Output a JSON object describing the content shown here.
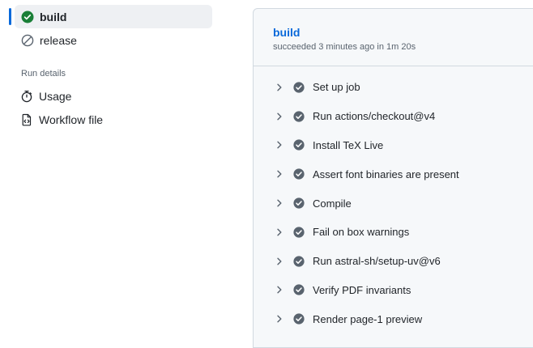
{
  "sidebar": {
    "jobs": [
      {
        "label": "build",
        "icon": "check-circle-fill-icon",
        "status": "success",
        "active": true
      },
      {
        "label": "release",
        "icon": "skipped-icon",
        "status": "skipped",
        "active": false
      }
    ],
    "run_details_title": "Run details",
    "details": [
      {
        "label": "Usage",
        "icon": "stopwatch-icon"
      },
      {
        "label": "Workflow file",
        "icon": "file-code-icon"
      }
    ]
  },
  "job": {
    "title": "build",
    "status_text": "succeeded 3 minutes ago in 1m 20s"
  },
  "steps": [
    {
      "label": "Set up job"
    },
    {
      "label": "Run actions/checkout@v4"
    },
    {
      "label": "Install TeX Live"
    },
    {
      "label": "Assert font binaries are present"
    },
    {
      "label": "Compile"
    },
    {
      "label": "Fail on box warnings"
    },
    {
      "label": "Run astral-sh/setup-uv@v6"
    },
    {
      "label": "Verify PDF invariants"
    },
    {
      "label": "Render page-1 preview"
    }
  ],
  "colors": {
    "accent": "#0969da",
    "success": "#1a7f37",
    "step_check": "#59636e"
  }
}
